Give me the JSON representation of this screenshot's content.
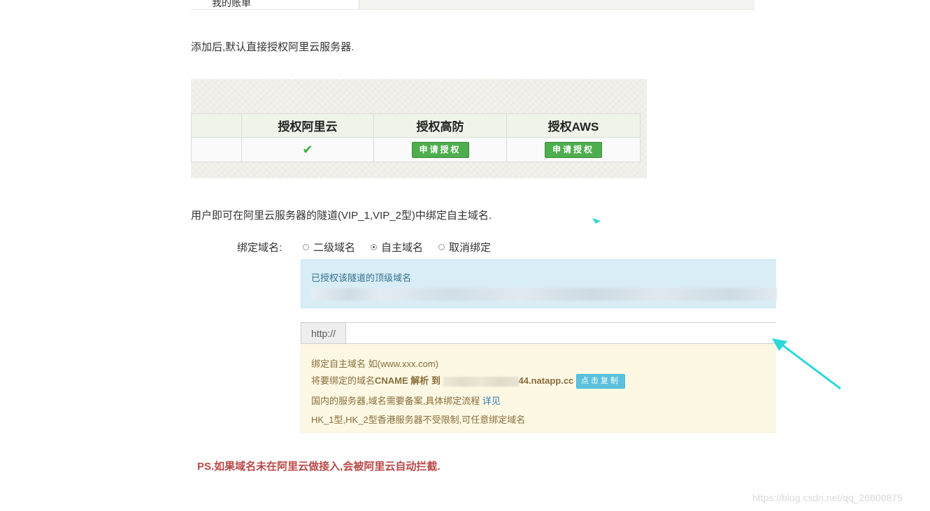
{
  "top_strip": {
    "cut_text": "我的账单"
  },
  "intro_text": "添加后,默认直接授权阿里云服务器.",
  "auth_table": {
    "headers": [
      "",
      "授权阿里云",
      "授权高防",
      "授权AWS"
    ],
    "check_symbol": "✔",
    "apply_label": "申请授权"
  },
  "user_text": "用户即可在阿里云服务器的隧道(VIP_1,VIP_2型)中绑定自主域名.",
  "bind": {
    "label": "绑定域名:",
    "options": [
      {
        "label": "二级域名",
        "checked": false
      },
      {
        "label": "自主域名",
        "checked": true
      },
      {
        "label": "取消绑定",
        "checked": false
      }
    ]
  },
  "info_box": {
    "title": "已授权该隧道的顶级域名"
  },
  "url_field": {
    "prefix": "http://",
    "value": ""
  },
  "warn_box": {
    "line1": "绑定自主域名 如(www.xxx.com)",
    "line2_prefix": "将要绑定的域名",
    "line2_cname": "CNAME 解析 到",
    "line2_domain_suffix": "44.natapp.cc",
    "copy_label": "点击复制",
    "line3_text": "国内的服务器,域名需要备案,具体绑定流程",
    "line3_link": "详见",
    "line4": "HK_1型,HK_2型香港服务器不受限制,可任意绑定域名"
  },
  "ps_note": "PS.如果域名未在阿里云做接入,会被阿里云自动拦截.",
  "watermark": "https://blog.csdn.net/qq_26800875",
  "colors": {
    "arrow": "#2ed8d8",
    "ps_red": "#b94a48",
    "apply_green": "#4cae4c",
    "copy_blue": "#5bc0de"
  }
}
